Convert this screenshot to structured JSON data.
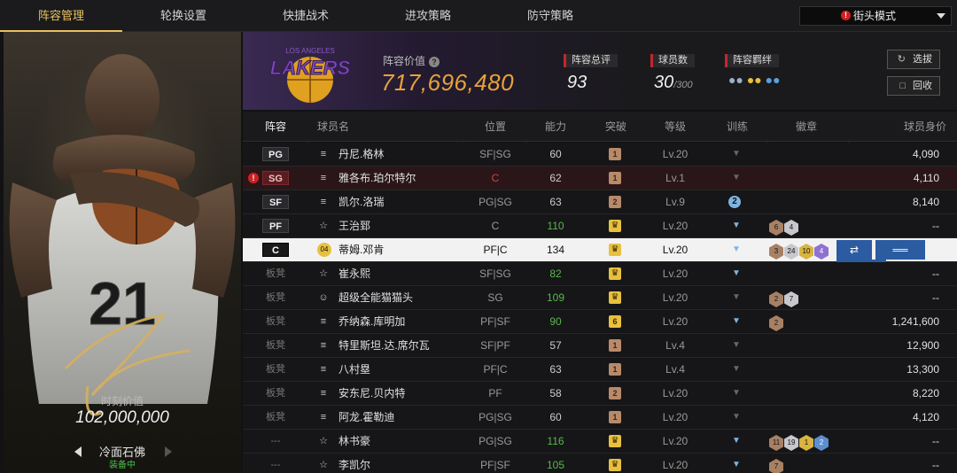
{
  "nav": {
    "tabs": [
      "阵容管理",
      "轮换设置",
      "快捷战术",
      "进攻策略",
      "防守策略"
    ],
    "mode": "街头模式"
  },
  "player_card": {
    "jersey": "21",
    "value_label": "时刻价值",
    "value": "102,000,000",
    "name": "冷面石佛",
    "status": "装备中"
  },
  "header": {
    "team_logo": "LAKERS",
    "team_logo_top": "LOS ANGELES",
    "roster_value_label": "阵容价值",
    "roster_value": "717,696,480",
    "overall_label": "阵容总评",
    "overall": "93",
    "players_label": "球员数",
    "players_count": "30",
    "players_max": "/300",
    "bond_label": "阵容羁绊",
    "btn_select": "选拔",
    "btn_recycle": "回收"
  },
  "columns": [
    "阵容",
    "球员名",
    "位置",
    "能力",
    "突破",
    "等级",
    "训练",
    "徽章",
    "球员身价"
  ],
  "rows": [
    {
      "slot": "PG",
      "name": "丹尼.格林",
      "pos": "SF|SG",
      "ability": "60",
      "level": "Lv.20",
      "worth": "4,090"
    },
    {
      "slot": "SG",
      "name": "雅各布.珀尔特尔",
      "pos": "C",
      "ability": "62",
      "level": "Lv.1",
      "worth": "4,110"
    },
    {
      "slot": "SF",
      "name": "凯尔.洛瑞",
      "pos": "PG|SG",
      "ability": "63",
      "level": "Lv.9",
      "worth": "8,140"
    },
    {
      "slot": "PF",
      "name": "王治郅",
      "pos": "C",
      "ability": "110",
      "level": "Lv.20",
      "worth": "--"
    },
    {
      "slot": "C",
      "name": "蒂姆.邓肯",
      "pos": "PF|C",
      "ability": "134",
      "level": "Lv.20",
      "worth": ""
    },
    {
      "slot": "板凳",
      "name": "崔永熙",
      "pos": "SF|SG",
      "ability": "82",
      "level": "Lv.20",
      "worth": "--"
    },
    {
      "slot": "板凳",
      "name": "超级全能猫猫头",
      "pos": "SG",
      "ability": "109",
      "level": "Lv.20",
      "worth": "--"
    },
    {
      "slot": "板凳",
      "name": "乔纳森.库明加",
      "pos": "PF|SF",
      "ability": "90",
      "level": "Lv.20",
      "worth": "1,241,600"
    },
    {
      "slot": "板凳",
      "name": "特里斯坦.达.席尔瓦",
      "pos": "SF|PF",
      "ability": "57",
      "level": "Lv.4",
      "worth": "12,900"
    },
    {
      "slot": "板凳",
      "name": "八村塁",
      "pos": "PF|C",
      "ability": "63",
      "level": "Lv.4",
      "worth": "13,300"
    },
    {
      "slot": "板凳",
      "name": "安东尼.贝内特",
      "pos": "PF",
      "ability": "58",
      "level": "Lv.20",
      "worth": "8,220"
    },
    {
      "slot": "板凳",
      "name": "阿龙.霍勒迪",
      "pos": "PG|SG",
      "ability": "60",
      "level": "Lv.20",
      "worth": "4,120"
    },
    {
      "slot": "---",
      "name": "林书豪",
      "pos": "PG|SG",
      "ability": "116",
      "level": "Lv.20",
      "worth": "--"
    },
    {
      "slot": "---",
      "name": "李凯尔",
      "pos": "PF|SF",
      "ability": "105",
      "level": "Lv.20",
      "worth": "--"
    }
  ],
  "breakthrough": [
    "1",
    "1",
    "2",
    "",
    "",
    "",
    "",
    "6",
    "1",
    "1",
    "2",
    "1",
    "",
    ""
  ],
  "jersey_badge": "04",
  "badges": {
    "r3": [
      "6",
      "4"
    ],
    "r4": [
      "3",
      "24",
      "10",
      "4"
    ],
    "r6": [
      "2",
      "7"
    ],
    "r7": [
      "2"
    ],
    "r12": [
      "11",
      "19",
      "1",
      "2"
    ],
    "r13": [
      "7"
    ]
  },
  "colors": {
    "accent": "#e8c060",
    "value": "#e6a23c",
    "warning": "#d02020",
    "ability_green": "#56b84a",
    "action_blue": "#2b5ba0"
  },
  "icons": {
    "mode": "alert-circle-icon",
    "select": "refresh-icon",
    "recycle": "document-icon",
    "info": "info-icon"
  }
}
